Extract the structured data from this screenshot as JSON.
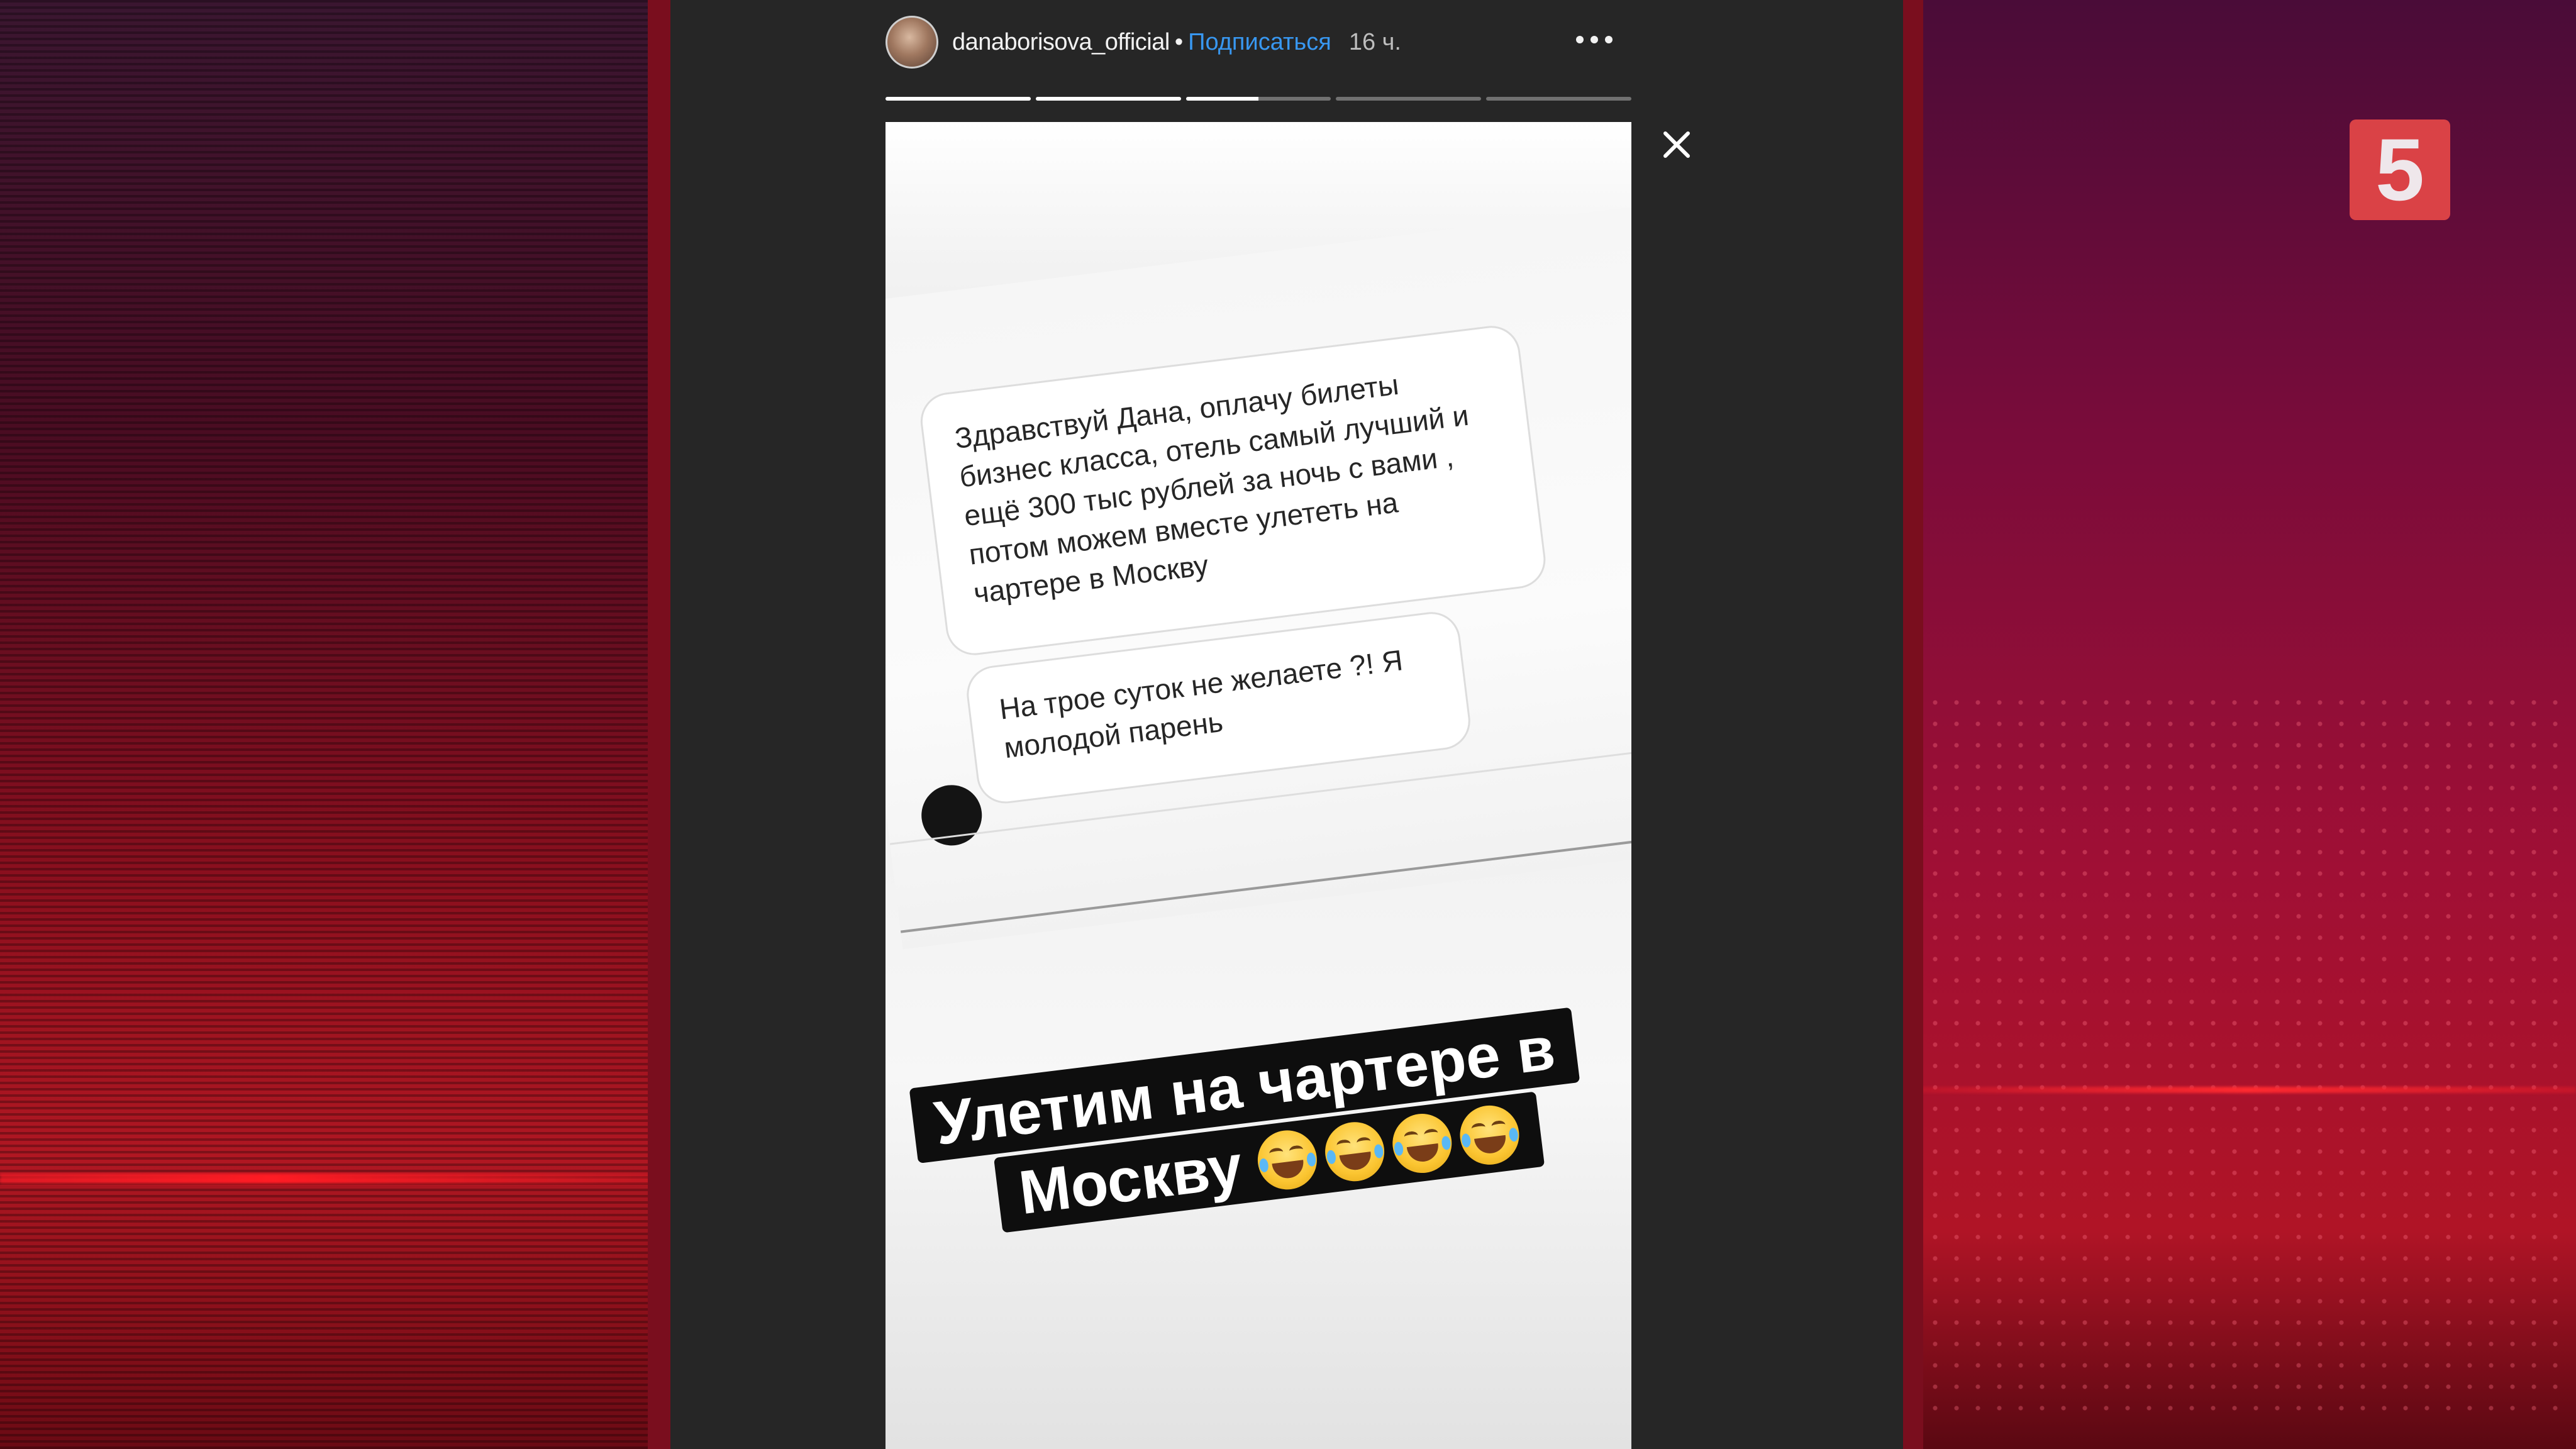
{
  "story": {
    "username": "danaborisova_official",
    "separator": "•",
    "follow_label": "Подписаться",
    "time_ago": "16 ч.",
    "progress": [
      1.0,
      1.0,
      0.5,
      0.0,
      0.0
    ],
    "messages": [
      "Здравствуй Дана, оплачу билеты бизнес класса, отель самый лучший и ещё 300 тыс рублей за ночь с вами , потом можем вместе улететь на чартере в Москву",
      "На трое суток не желаете ?! Я молодой парень"
    ],
    "caption_line1": "Улетим на чартере в",
    "caption_line2": "Москву",
    "caption_emoji": [
      "laughing-tears-emoji",
      "laughing-tears-emoji",
      "laughing-tears-emoji",
      "laughing-tears-emoji"
    ]
  },
  "broadcast": {
    "channel_logo": "5",
    "accent_color": "#e84848"
  },
  "icons": {
    "more": "more-icon",
    "close": "close-icon"
  }
}
